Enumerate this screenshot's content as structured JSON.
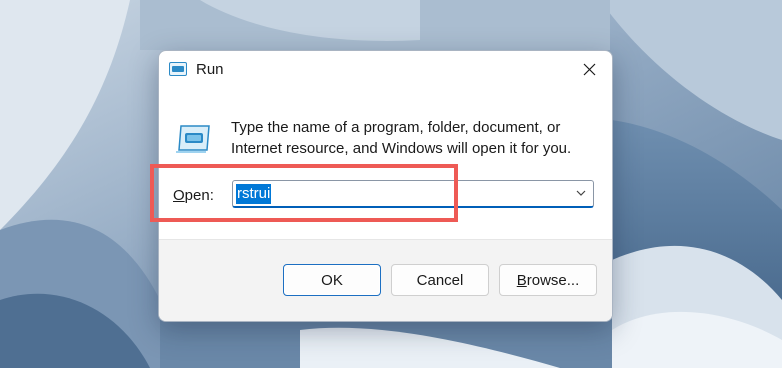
{
  "dialog": {
    "title": "Run",
    "description": "Type the name of a program, folder, document, or Internet resource, and Windows will open it for you.",
    "open_label_key": "O",
    "open_label_rest": "pen:",
    "input_value": "rstrui",
    "buttons": {
      "ok": "OK",
      "cancel": "Cancel",
      "browse_key": "B",
      "browse_rest": "rowse..."
    }
  },
  "colors": {
    "accent": "#005fb8",
    "selection": "#0078d7",
    "highlight_box": "#ee5a55"
  },
  "icons": {
    "title": "run-icon",
    "body": "run-large-icon",
    "close": "close-icon",
    "dropdown": "chevron-down-icon"
  }
}
